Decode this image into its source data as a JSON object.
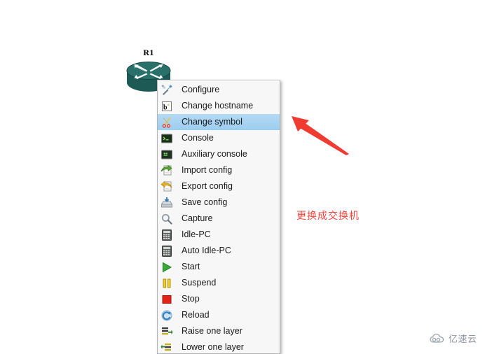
{
  "canvas": {
    "background_color": "#ffffff"
  },
  "node": {
    "label": "R1",
    "icon": "router-icon",
    "body_color": "#1f5c58",
    "top_color": "#2c7a72"
  },
  "context_menu": {
    "name": "node-context-menu",
    "background_color": "#f7f7f7",
    "border_color": "#b4b4b4",
    "highlight_color": "#a9d5f2",
    "items": [
      {
        "label": "Configure",
        "icon": "screwdriver-wrench-icon",
        "selected": false
      },
      {
        "label": "Change hostname",
        "icon": "rename-text-icon",
        "selected": false
      },
      {
        "label": "Change symbol",
        "icon": "scissors-icon",
        "selected": true
      },
      {
        "label": "Console",
        "icon": "terminal-icon",
        "selected": false
      },
      {
        "label": "Auxiliary console",
        "icon": "terminal-aux-icon",
        "selected": false
      },
      {
        "label": "Import config",
        "icon": "import-arrow-icon",
        "selected": false
      },
      {
        "label": "Export config",
        "icon": "export-arrow-icon",
        "selected": false
      },
      {
        "label": "Save config",
        "icon": "save-disk-icon",
        "selected": false
      },
      {
        "label": "Capture",
        "icon": "magnifier-icon",
        "selected": false
      },
      {
        "label": "Idle-PC",
        "icon": "calculator-icon",
        "selected": false
      },
      {
        "label": "Auto Idle-PC",
        "icon": "calculator-icon",
        "selected": false
      },
      {
        "label": "Start",
        "icon": "play-icon",
        "selected": false
      },
      {
        "label": "Suspend",
        "icon": "pause-icon",
        "selected": false
      },
      {
        "label": "Stop",
        "icon": "stop-icon",
        "selected": false
      },
      {
        "label": "Reload",
        "icon": "reload-icon",
        "selected": false
      },
      {
        "label": "Raise one layer",
        "icon": "raise-layer-icon",
        "selected": false
      },
      {
        "label": "Lower one layer",
        "icon": "lower-layer-icon",
        "selected": false
      }
    ]
  },
  "annotation": {
    "text": "更换成交换机",
    "color": "#f4433a",
    "arrow": "red-arrow-pointing-up-left"
  },
  "watermark": {
    "text": "亿速云",
    "icon": "cloud-logo-icon",
    "color": "#7c8494"
  }
}
